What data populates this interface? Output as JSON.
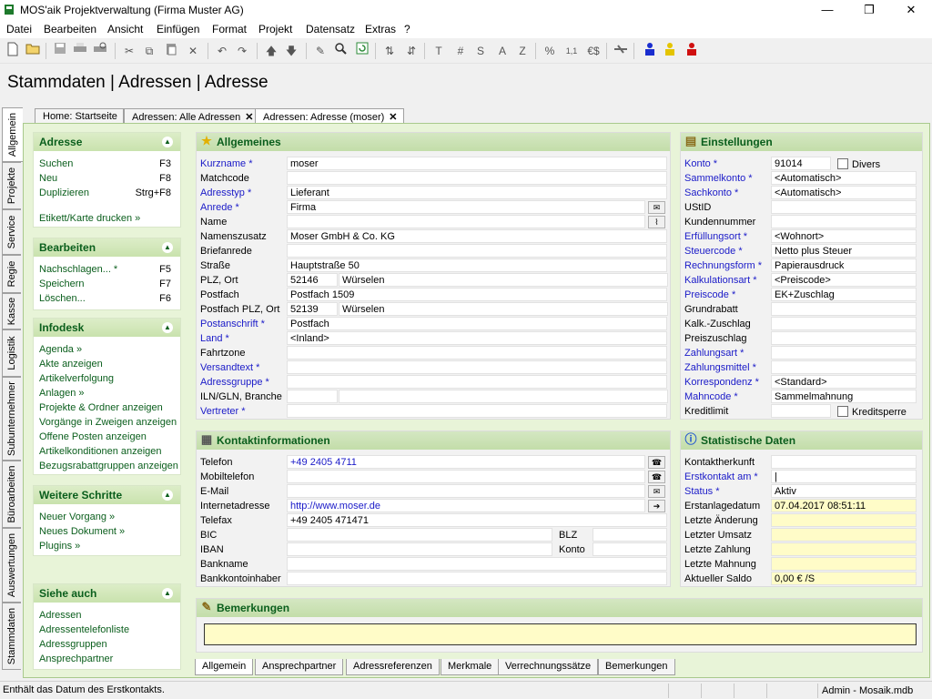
{
  "window": {
    "title": "MOS'aik Projektverwaltung (Firma Muster AG)",
    "minimize": "—",
    "maximize": "❐",
    "close": "✕"
  },
  "menu": [
    "Datei",
    "Bearbeiten",
    "Ansicht",
    "Einfügen",
    "Format",
    "Projekt",
    "Datensatz",
    "Extras",
    "?"
  ],
  "toolbar": {
    "icons": [
      "new-document",
      "open-folder",
      "save",
      "print",
      "print-preview",
      "cut",
      "copy",
      "paste",
      "delete",
      "undo",
      "redo",
      "arrow-up",
      "arrow-down",
      "edit-pencil",
      "search",
      "refresh",
      "sort-asc",
      "sort-desc",
      "T",
      "#",
      "S",
      "A",
      "Z",
      "%",
      "1,1",
      "€$",
      "disconnect",
      "user-blue",
      "user-yellow",
      "user-red"
    ],
    "text_glyphs": {
      "T": "T",
      "#": "#",
      "S": "S",
      "A": "A",
      "Z": "Z",
      "%": "%",
      "1,1": "1,1",
      "€$": "€$"
    }
  },
  "page_title": "Stammdaten | Adressen | Adresse",
  "vertical_tabs": [
    "Allgemein",
    "Projekte",
    "Service",
    "Regie",
    "Kasse",
    "Logistik",
    "Subunternehmer",
    "Büroarbeiten",
    "Auswertungen",
    "Stammdaten"
  ],
  "doc_tabs": [
    {
      "label": "Home: Startseite",
      "closable": false
    },
    {
      "label": "Adressen: Alle Adressen",
      "closable": true
    },
    {
      "label": "Adressen: Adresse (moser)",
      "closable": true,
      "active": true
    }
  ],
  "doc_tab_close": "✕",
  "sidebar": {
    "collapse_glyph": "▲",
    "adresse": {
      "title": "Adresse",
      "items": [
        {
          "label": "Suchen",
          "key": "F3"
        },
        {
          "label": "Neu",
          "key": "F8"
        },
        {
          "label": "Duplizieren",
          "key": "Strg+F8"
        }
      ],
      "extra": "Etikett/Karte drucken »"
    },
    "bearbeiten": {
      "title": "Bearbeiten",
      "items": [
        {
          "label": "Nachschlagen... *",
          "key": "F5"
        },
        {
          "label": "Speichern",
          "key": "F7"
        },
        {
          "label": "Löschen...",
          "key": "F6"
        }
      ]
    },
    "infodesk": {
      "title": "Infodesk",
      "items": [
        "Agenda »",
        "Akte anzeigen",
        "Artikelverfolgung",
        "Anlagen »",
        "Projekte & Ordner anzeigen",
        "Vorgänge in Zweigen anzeigen",
        "Offene Posten anzeigen",
        "Artikelkonditionen anzeigen",
        "Bezugsrabattgruppen anzeigen"
      ]
    },
    "weitere": {
      "title": "Weitere Schritte",
      "items": [
        "Neuer Vorgang »",
        "Neues Dokument »",
        "Plugins »"
      ]
    },
    "siehe": {
      "title": "Siehe auch",
      "items": [
        "Adressen",
        "Adressentelefonliste",
        "Adressgruppen",
        "Ansprechpartner"
      ]
    }
  },
  "allgemeines": {
    "title": "Allgemeines",
    "rows": [
      {
        "label": "Kurzname *",
        "req": true,
        "value": "moser"
      },
      {
        "label": "Matchcode",
        "req": false,
        "value": ""
      },
      {
        "label": "Adresstyp *",
        "req": true,
        "value": "Lieferant"
      },
      {
        "label": "Anrede *",
        "req": true,
        "value": "Firma"
      },
      {
        "label": "Name",
        "req": false,
        "value": ""
      },
      {
        "label": "Namenszusatz",
        "req": false,
        "value": "Moser GmbH & Co. KG"
      },
      {
        "label": "Briefanrede",
        "req": false,
        "value": ""
      },
      {
        "label": "Straße",
        "req": false,
        "value": "Hauptstraße 50"
      },
      {
        "label": "PLZ, Ort",
        "req": false,
        "value": "52146",
        "value2": "Würselen"
      },
      {
        "label": "Postfach",
        "req": false,
        "value": "Postfach 1509"
      },
      {
        "label": "Postfach PLZ, Ort",
        "req": false,
        "value": "52139",
        "value2": "Würselen"
      },
      {
        "label": "Postanschrift *",
        "req": true,
        "value": "Postfach"
      },
      {
        "label": "Land *",
        "req": true,
        "value": "<Inland>"
      },
      {
        "label": "Fahrtzone",
        "req": false,
        "value": ""
      },
      {
        "label": "Versandtext *",
        "req": true,
        "value": ""
      },
      {
        "label": "Adressgruppe *",
        "req": true,
        "value": ""
      },
      {
        "label": "ILN/GLN, Branche",
        "req": false,
        "value": "",
        "value2": ""
      },
      {
        "label": "Vertreter *",
        "req": true,
        "value": ""
      }
    ]
  },
  "einstellungen": {
    "title": "Einstellungen",
    "divers_label": "Divers",
    "kreditsperre_label": "Kreditsperre",
    "rows": [
      {
        "label": "Konto *",
        "req": true,
        "value": "91014"
      },
      {
        "label": "Sammelkonto *",
        "req": true,
        "value": "<Automatisch>"
      },
      {
        "label": "Sachkonto *",
        "req": true,
        "value": "<Automatisch>"
      },
      {
        "label": "UStID",
        "req": false,
        "value": ""
      },
      {
        "label": "Kundennummer",
        "req": false,
        "value": ""
      },
      {
        "label": "Erfüllungsort *",
        "req": true,
        "value": "<Wohnort>"
      },
      {
        "label": "Steuercode *",
        "req": true,
        "value": "Netto plus Steuer"
      },
      {
        "label": "Rechnungsform *",
        "req": true,
        "value": "Papierausdruck"
      },
      {
        "label": "Kalkulationsart *",
        "req": true,
        "value": "<Preiscode>"
      },
      {
        "label": "Preiscode *",
        "req": true,
        "value": "EK+Zuschlag"
      },
      {
        "label": "Grundrabatt",
        "req": false,
        "value": ""
      },
      {
        "label": "Kalk.-Zuschlag",
        "req": false,
        "value": ""
      },
      {
        "label": "Preiszuschlag",
        "req": false,
        "value": ""
      },
      {
        "label": "Zahlungsart *",
        "req": true,
        "value": ""
      },
      {
        "label": "Zahlungsmittel *",
        "req": true,
        "value": ""
      },
      {
        "label": "Korrespondenz *",
        "req": true,
        "value": "<Standard>"
      },
      {
        "label": "Mahncode *",
        "req": true,
        "value": "Sammelmahnung"
      },
      {
        "label": "Kreditlimit",
        "req": false,
        "value": ""
      }
    ]
  },
  "kontakt": {
    "title": "Kontaktinformationen",
    "rows": [
      {
        "label": "Telefon",
        "value": "+49 2405 4711",
        "link": true
      },
      {
        "label": "Mobiltelefon",
        "value": ""
      },
      {
        "label": "E-Mail",
        "value": ""
      },
      {
        "label": "Internetadresse",
        "value": "http://www.moser.de",
        "link": true
      },
      {
        "label": "Telefax",
        "value": "+49 2405 471471"
      },
      {
        "label": "BIC",
        "value": "",
        "label2": "BLZ",
        "value2": ""
      },
      {
        "label": "IBAN",
        "value": "",
        "label2": "Konto",
        "value2": ""
      },
      {
        "label": "Bankname",
        "value": ""
      },
      {
        "label": "Bankkontoinhaber",
        "value": ""
      }
    ]
  },
  "statistik": {
    "title": "Statistische Daten",
    "rows": [
      {
        "label": "Kontaktherkunft",
        "req": false,
        "value": ""
      },
      {
        "label": "Erstkontakt am *",
        "req": true,
        "value": "|"
      },
      {
        "label": "Status *",
        "req": true,
        "value": "Aktiv"
      },
      {
        "label": "Erstanlagedatum",
        "req": false,
        "value": "07.04.2017 08:51:11",
        "yel": true
      },
      {
        "label": "Letzte Änderung",
        "req": false,
        "value": "",
        "yel": true
      },
      {
        "label": "Letzter Umsatz",
        "req": false,
        "value": "",
        "yel": true
      },
      {
        "label": "Letzte Zahlung",
        "req": false,
        "value": "",
        "yel": true
      },
      {
        "label": "Letzte Mahnung",
        "req": false,
        "value": "",
        "yel": true
      },
      {
        "label": "Aktueller Saldo",
        "req": false,
        "value": "0,00 € /S",
        "yel": true
      }
    ]
  },
  "bemerkungen": {
    "title": "Bemerkungen",
    "value": ""
  },
  "bottom_tabs": [
    "Allgemein",
    "Ansprechpartner",
    "Adressreferenzen",
    "Merkmale",
    "Verrechnungssätze",
    "Bemerkungen"
  ],
  "status": {
    "message": "Enthält das Datum des Erstkontakts.",
    "user": "Admin - Mosaik.mdb"
  },
  "colors": {
    "accent_green": "#0a5e1c",
    "required_blue": "#1a1ac8",
    "readonly_yellow": "#fffcc8",
    "frame_green": "#e8f4d8"
  }
}
